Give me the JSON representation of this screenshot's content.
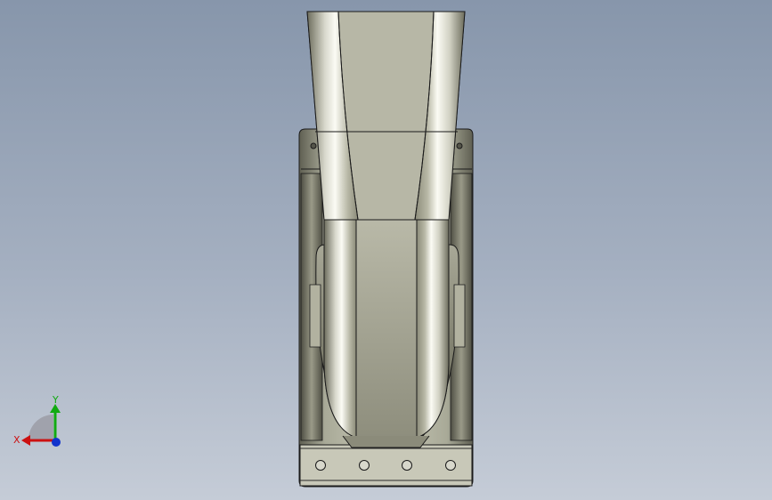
{
  "viewport": {
    "background_top": "#8796ab",
    "background_bottom": "#c5ccd7"
  },
  "model": {
    "description_icon": "duct-elbow-with-mounting-bracket-icon",
    "body_color": "#9b9c8a",
    "highlight_color": "#f2f2ec",
    "mounting_holes": 4
  },
  "triad": {
    "x_label": "X",
    "y_label": "Y",
    "x_color": "#cc1111",
    "y_color": "#11aa11",
    "z_color": "#1133cc"
  }
}
